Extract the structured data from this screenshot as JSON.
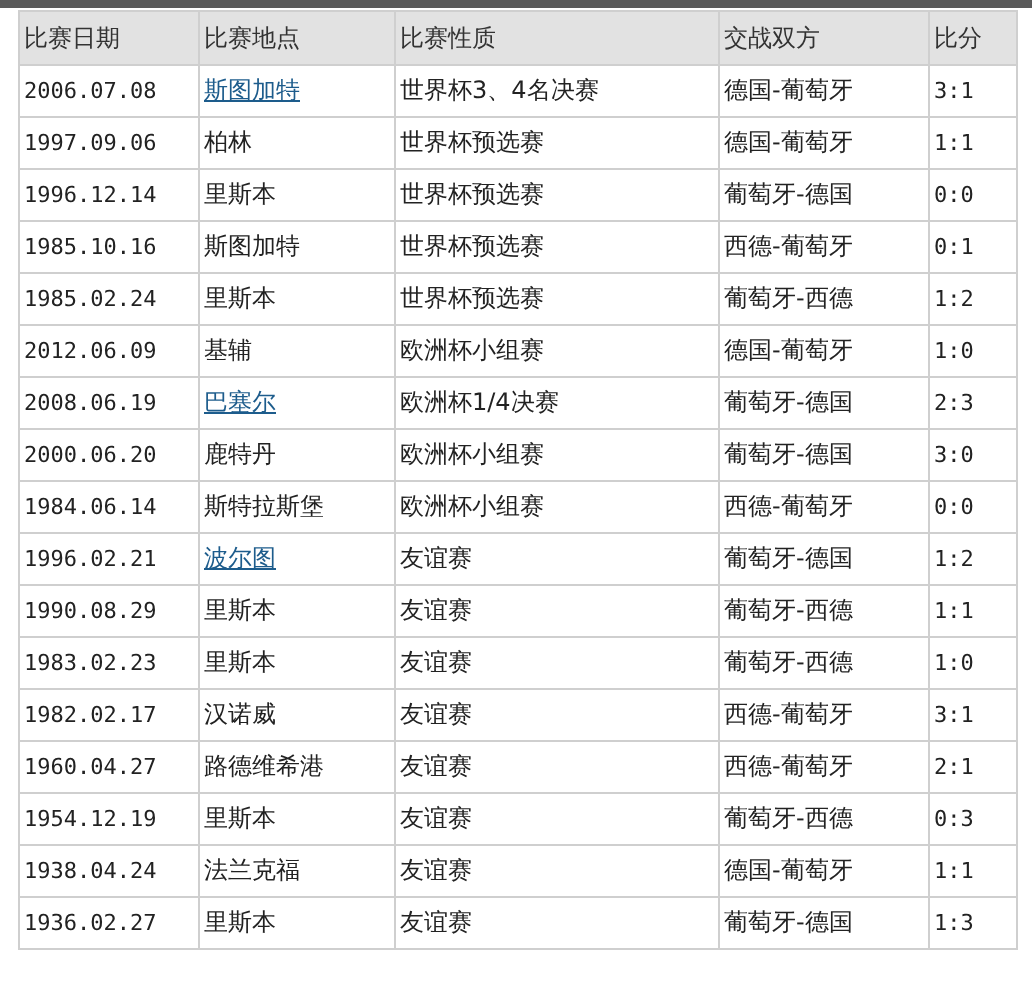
{
  "table": {
    "columns": [
      "比赛日期",
      "比赛地点",
      "比赛性质",
      "交战双方",
      "比分"
    ],
    "rows": [
      {
        "date": "2006.07.08",
        "place": "斯图加特",
        "place_link": true,
        "type": "世界杯3、4名决赛",
        "teams": "德国-葡萄牙",
        "score": "3:1"
      },
      {
        "date": "1997.09.06",
        "place": "柏林",
        "place_link": false,
        "type": "世界杯预选赛",
        "teams": "德国-葡萄牙",
        "score": "1:1"
      },
      {
        "date": "1996.12.14",
        "place": "里斯本",
        "place_link": false,
        "type": "世界杯预选赛",
        "teams": "葡萄牙-德国",
        "score": "0:0"
      },
      {
        "date": "1985.10.16",
        "place": "斯图加特",
        "place_link": false,
        "type": "世界杯预选赛",
        "teams": "西德-葡萄牙",
        "score": "0:1"
      },
      {
        "date": "1985.02.24",
        "place": "里斯本",
        "place_link": false,
        "type": "世界杯预选赛",
        "teams": "葡萄牙-西德",
        "score": "1:2"
      },
      {
        "date": "2012.06.09",
        "place": "基辅",
        "place_link": false,
        "type": "欧洲杯小组赛",
        "teams": "德国-葡萄牙",
        "score": "1:0"
      },
      {
        "date": "2008.06.19",
        "place": "巴塞尔",
        "place_link": true,
        "type": "欧洲杯1/4决赛",
        "teams": "葡萄牙-德国",
        "score": "2:3"
      },
      {
        "date": "2000.06.20",
        "place": "鹿特丹",
        "place_link": false,
        "type": "欧洲杯小组赛",
        "teams": "葡萄牙-德国",
        "score": "3:0"
      },
      {
        "date": "1984.06.14",
        "place": "斯特拉斯堡",
        "place_link": false,
        "type": "欧洲杯小组赛",
        "teams": "西德-葡萄牙",
        "score": "0:0"
      },
      {
        "date": "1996.02.21",
        "place": "波尔图",
        "place_link": true,
        "type": "友谊赛",
        "teams": "葡萄牙-德国",
        "score": "1:2"
      },
      {
        "date": "1990.08.29",
        "place": "里斯本",
        "place_link": false,
        "type": "友谊赛",
        "teams": "葡萄牙-西德",
        "score": "1:1"
      },
      {
        "date": "1983.02.23",
        "place": "里斯本",
        "place_link": false,
        "type": "友谊赛",
        "teams": "葡萄牙-西德",
        "score": "1:0"
      },
      {
        "date": "1982.02.17",
        "place": "汉诺威",
        "place_link": false,
        "type": "友谊赛",
        "teams": "西德-葡萄牙",
        "score": "3:1"
      },
      {
        "date": "1960.04.27",
        "place": "路德维希港",
        "place_link": false,
        "type": "友谊赛",
        "teams": "西德-葡萄牙",
        "score": "2:1"
      },
      {
        "date": "1954.12.19",
        "place": "里斯本",
        "place_link": false,
        "type": "友谊赛",
        "teams": "葡萄牙-西德",
        "score": "0:3"
      },
      {
        "date": "1938.04.24",
        "place": "法兰克福",
        "place_link": false,
        "type": "友谊赛",
        "teams": "德国-葡萄牙",
        "score": "1:1"
      },
      {
        "date": "1936.02.27",
        "place": "里斯本",
        "place_link": false,
        "type": "友谊赛",
        "teams": "葡萄牙-德国",
        "score": "1:3"
      }
    ]
  }
}
